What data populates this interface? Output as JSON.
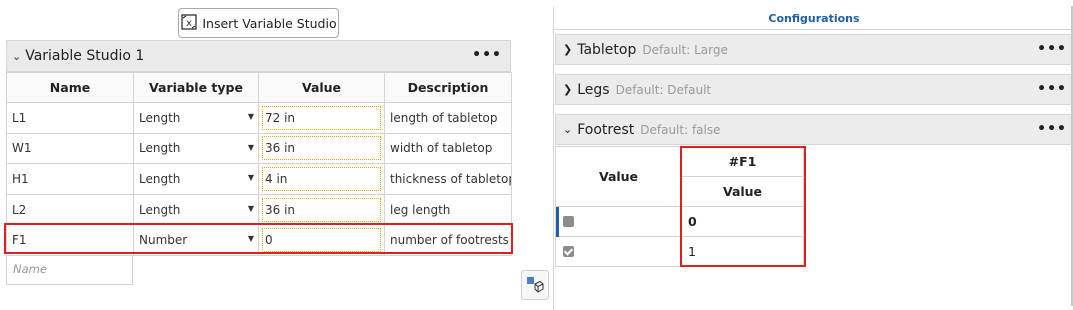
{
  "toolbar": {
    "insert_label": "Insert Variable Studio",
    "insert_icon": "variable-studio-icon"
  },
  "variable_studio": {
    "title": "Variable Studio 1",
    "more": "•••",
    "columns": {
      "name": "Name",
      "type": "Variable type",
      "value": "Value",
      "description": "Description"
    },
    "rows": [
      {
        "name": "L1",
        "type": "Length",
        "value": "72 in",
        "description": "length of tabletop"
      },
      {
        "name": "W1",
        "type": "Length",
        "value": "36 in",
        "description": "width of tabletop"
      },
      {
        "name": "H1",
        "type": "Length",
        "value": "4 in",
        "description": "thickness of tabletop"
      },
      {
        "name": "L2",
        "type": "Length",
        "value": "36 in",
        "description": "leg length"
      },
      {
        "name": "F1",
        "type": "Number",
        "value": "0",
        "description": "number of footrests"
      }
    ],
    "new_name_placeholder": "Name"
  },
  "configurations": {
    "title": "Configurations",
    "more": "•••",
    "items": [
      {
        "label": "Tabletop",
        "default": "Default: Large",
        "expanded": false
      },
      {
        "label": "Legs",
        "default": "Default: Default",
        "expanded": false
      },
      {
        "label": "Footrest",
        "default": "Default: false",
        "expanded": true
      }
    ],
    "footrest_table": {
      "value_header": "Value",
      "f1_header": "#F1",
      "f1_subheader": "Value",
      "rows": [
        {
          "checked": false,
          "f1": "0"
        },
        {
          "checked": true,
          "f1": "1"
        }
      ]
    }
  },
  "colors": {
    "accent": "#1f5fae",
    "highlight": "#e0201f",
    "value_border": "#e6a817"
  }
}
